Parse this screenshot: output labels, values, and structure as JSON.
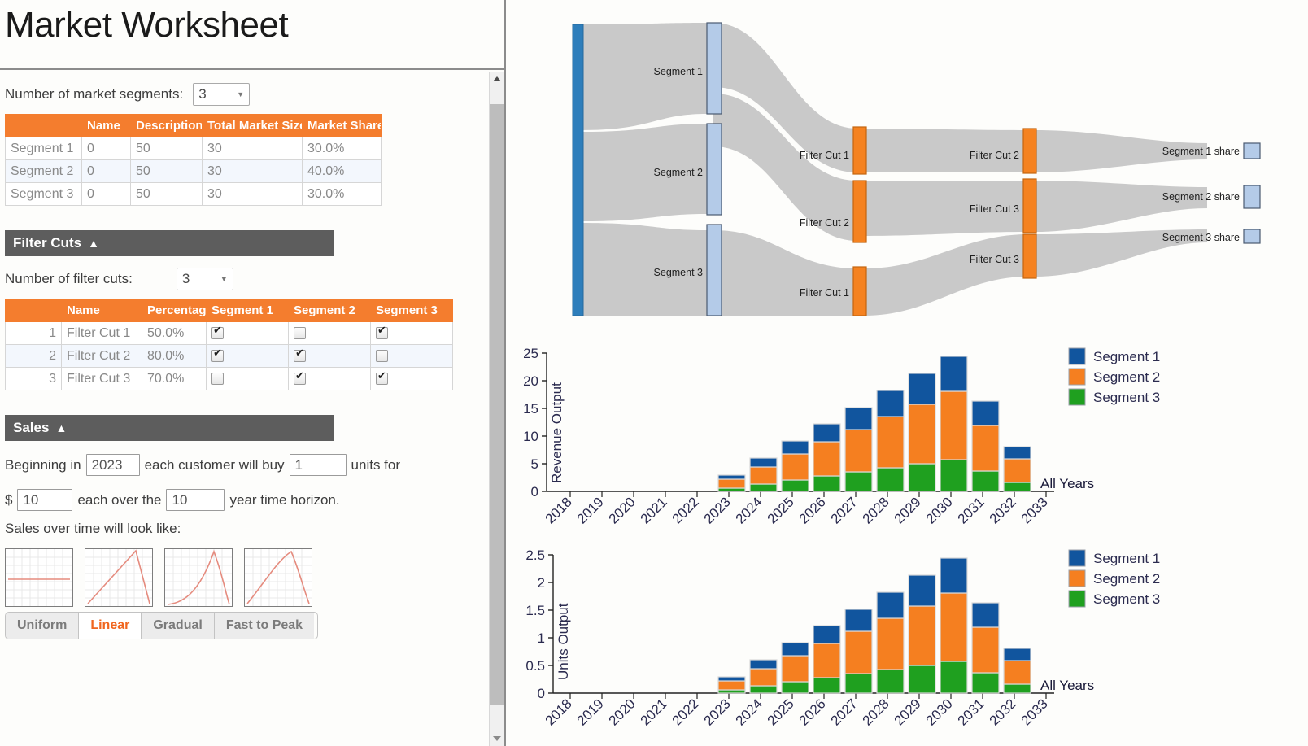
{
  "header": {
    "title": "Market Worksheet"
  },
  "segments_section": {
    "label": "Number of market segments:",
    "count": "3",
    "columns": [
      "",
      "Name",
      "Description",
      "Total Market Size",
      "Market Share"
    ],
    "rows": [
      {
        "row_header": "Segment 1",
        "name": "0",
        "description": "50",
        "total_market_size": "30",
        "market_share": "30.0%"
      },
      {
        "row_header": "Segment 2",
        "name": "0",
        "description": "50",
        "total_market_size": "30",
        "market_share": "40.0%"
      },
      {
        "row_header": "Segment 3",
        "name": "0",
        "description": "50",
        "total_market_size": "30",
        "market_share": "30.0%"
      }
    ]
  },
  "filter_cuts_section": {
    "title": "Filter Cuts",
    "collapse_icon": "chevron-up",
    "label": "Number of filter cuts:",
    "count": "3",
    "columns": [
      "",
      "Name",
      "Percentage",
      "Segment 1",
      "Segment 2",
      "Segment 3"
    ],
    "rows": [
      {
        "index": "1",
        "name": "Filter Cut 1",
        "percentage": "50.0%",
        "seg1": true,
        "seg2": false,
        "seg3": true
      },
      {
        "index": "2",
        "name": "Filter Cut 2",
        "percentage": "80.0%",
        "seg1": true,
        "seg2": true,
        "seg3": false
      },
      {
        "index": "3",
        "name": "Filter Cut 3",
        "percentage": "70.0%",
        "seg1": false,
        "seg2": true,
        "seg3": true
      }
    ]
  },
  "sales_section": {
    "title": "Sales",
    "collapse_icon": "chevron-up",
    "line1_a": "Beginning in",
    "year": "2023",
    "line1_b": "each customer will buy",
    "units": "1",
    "line1_c": "units for",
    "currency": "$",
    "price": "10",
    "line2_b": "each over the",
    "horizon": "10",
    "line2_c": "year time horizon.",
    "curve_label": "Sales over time will look like:",
    "curve_buttons": [
      "Uniform",
      "Linear",
      "Gradual",
      "Fast to Peak"
    ],
    "curve_selected": "Linear"
  },
  "sankey": {
    "source_node": "",
    "segment_nodes": [
      "Segment 1",
      "Segment 2",
      "Segment 3"
    ],
    "stage2_nodes": [
      "Filter Cut 1",
      "Filter Cut 2",
      "Filter Cut 1"
    ],
    "stage3_nodes": [
      "Filter Cut 2",
      "Filter Cut 3",
      "Filter Cut 3"
    ],
    "share_nodes": [
      "Segment 1 share",
      "Segment 2 share",
      "Segment 3 share"
    ],
    "colors": {
      "source": "#2e7ebb",
      "segment": "#b4cbe8",
      "filter": "#f58220",
      "share": "#b4cbe8",
      "link": "#c9c9c9"
    }
  },
  "colors": {
    "accent_orange": "#f47d2e",
    "section_gray": "#5d5d5d",
    "segment1": "#11559e",
    "segment2": "#f57f20",
    "segment3": "#1fa01f"
  },
  "chart_data": [
    {
      "type": "bar",
      "stacked": true,
      "title": "",
      "ylabel": "Revenue Output",
      "xlabel": "",
      "ylim": [
        0,
        26
      ],
      "yticks": [
        0,
        5,
        10,
        15,
        20,
        25
      ],
      "categories": [
        "2018",
        "2019",
        "2020",
        "2021",
        "2022",
        "2023",
        "2024",
        "2025",
        "2026",
        "2027",
        "2028",
        "2029",
        "2030",
        "2031",
        "2032",
        "2033"
      ],
      "legend_position": "right",
      "annotation": "All Years",
      "series": [
        {
          "name": "Segment 3",
          "color": "#1fa01f",
          "values": [
            0,
            0,
            0,
            0,
            0,
            0.6,
            1.3,
            2.0,
            2.8,
            3.5,
            4.2,
            5.0,
            5.7,
            3.7,
            1.7,
            0
          ]
        },
        {
          "name": "Segment 2",
          "color": "#f57f20",
          "values": [
            0,
            0,
            0,
            0,
            0,
            1.6,
            3.1,
            4.7,
            6.2,
            7.7,
            9.2,
            10.7,
            12.3,
            8.2,
            4.3,
            0
          ]
        },
        {
          "name": "Segment 1",
          "color": "#11559e",
          "values": [
            0,
            0,
            0,
            0,
            0,
            0.8,
            1.7,
            2.4,
            3.2,
            4.0,
            4.9,
            5.7,
            6.4,
            4.4,
            2.1,
            0
          ]
        }
      ],
      "totals": [
        0,
        0,
        0,
        0,
        0,
        3.0,
        6.1,
        9.1,
        12.2,
        15.2,
        18.3,
        21.4,
        24.4,
        16.3,
        8.1,
        0
      ]
    },
    {
      "type": "bar",
      "stacked": true,
      "title": "",
      "ylabel": "Units Output",
      "xlabel": "",
      "ylim": [
        0,
        2.6
      ],
      "yticks": [
        0,
        0.5,
        1,
        1.5,
        2,
        2.5
      ],
      "ytick_labels": [
        "0",
        "0.5",
        "1",
        "1.5",
        "2",
        "2.5"
      ],
      "categories": [
        "2018",
        "2019",
        "2020",
        "2021",
        "2022",
        "2023",
        "2024",
        "2025",
        "2026",
        "2027",
        "2028",
        "2029",
        "2030",
        "2031",
        "2032",
        "2033"
      ],
      "legend_position": "right",
      "annotation": "All Years",
      "series": [
        {
          "name": "Segment 3",
          "color": "#1fa01f",
          "values": [
            0,
            0,
            0,
            0,
            0,
            0.06,
            0.13,
            0.2,
            0.28,
            0.35,
            0.42,
            0.5,
            0.57,
            0.37,
            0.17,
            0
          ]
        },
        {
          "name": "Segment 2",
          "color": "#f57f20",
          "values": [
            0,
            0,
            0,
            0,
            0,
            0.16,
            0.31,
            0.47,
            0.62,
            0.77,
            0.92,
            1.07,
            1.23,
            0.82,
            0.43,
            0
          ]
        },
        {
          "name": "Segment 1",
          "color": "#11559e",
          "values": [
            0,
            0,
            0,
            0,
            0,
            0.08,
            0.17,
            0.24,
            0.32,
            0.4,
            0.49,
            0.57,
            0.64,
            0.44,
            0.21,
            0
          ]
        }
      ],
      "totals": [
        0,
        0,
        0,
        0,
        0,
        0.3,
        0.61,
        0.91,
        1.22,
        1.52,
        1.83,
        2.14,
        2.44,
        1.63,
        0.81,
        0
      ]
    }
  ],
  "legend": {
    "items": [
      "Segment 1",
      "Segment 2",
      "Segment 3"
    ]
  }
}
